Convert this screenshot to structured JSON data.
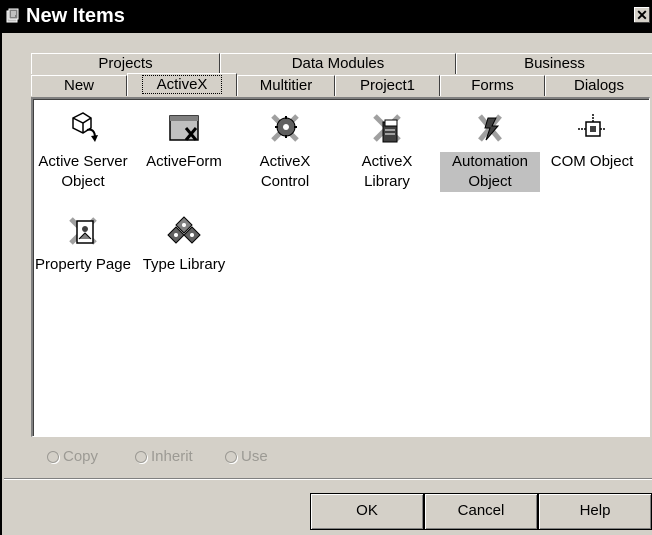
{
  "window": {
    "title": "New Items",
    "close_label": "✕"
  },
  "tabs_row1": [
    {
      "label": "Projects"
    },
    {
      "label": "Data Modules"
    },
    {
      "label": "Business"
    }
  ],
  "tabs_row2": [
    {
      "label": "New"
    },
    {
      "label": "ActiveX",
      "selected": true
    },
    {
      "label": "Multitier"
    },
    {
      "label": "Project1"
    },
    {
      "label": "Forms"
    },
    {
      "label": "Dialogs"
    }
  ],
  "items": [
    {
      "label": "Active Server Object",
      "icon": "active-server-object-icon"
    },
    {
      "label": "ActiveForm",
      "icon": "activeform-icon"
    },
    {
      "label": "ActiveX Control",
      "icon": "activex-control-icon"
    },
    {
      "label": "ActiveX Library",
      "icon": "activex-library-icon"
    },
    {
      "label": "Automation Object",
      "icon": "automation-object-icon",
      "selected": true
    },
    {
      "label": "COM Object",
      "icon": "com-object-icon"
    },
    {
      "label": "Property Page",
      "icon": "property-page-icon"
    },
    {
      "label": "Type Library",
      "icon": "type-library-icon"
    }
  ],
  "options": {
    "copy": "Copy",
    "inherit": "Inherit",
    "use": "Use"
  },
  "buttons": {
    "ok": "OK",
    "cancel": "Cancel",
    "help": "Help"
  },
  "colors": {
    "title_bg": "#000000",
    "face": "#d4d0c8",
    "selection": "#c0c0c0"
  }
}
